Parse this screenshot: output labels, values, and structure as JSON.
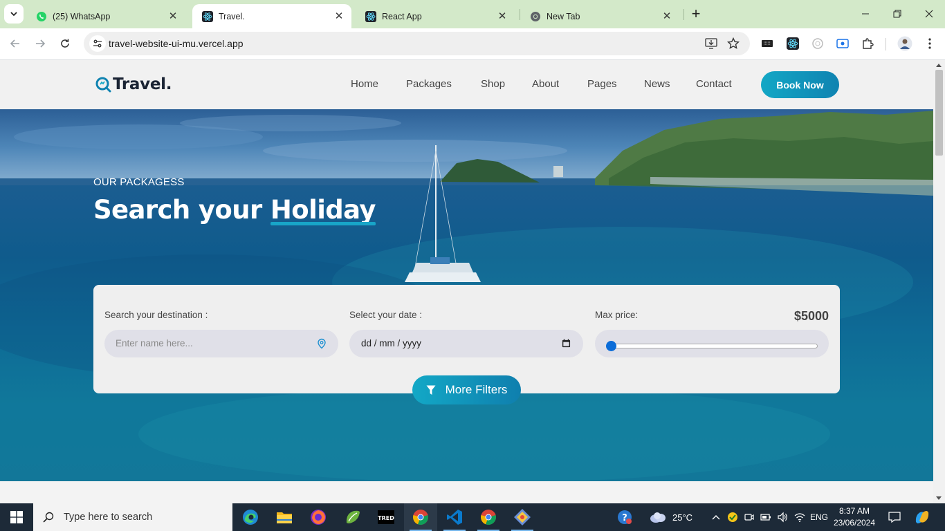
{
  "browser": {
    "tabs": [
      {
        "title": "(25) WhatsApp",
        "icon": "whatsapp-icon",
        "active": false
      },
      {
        "title": "Travel.",
        "icon": "react-icon",
        "active": true
      },
      {
        "title": "React App",
        "icon": "react-icon",
        "active": false
      },
      {
        "title": "New Tab",
        "icon": "chrome-icon",
        "active": false
      }
    ],
    "url": "travel-website-ui-mu.vercel.app"
  },
  "site": {
    "logo": "Travel.",
    "nav": [
      "Home",
      "Packages",
      "Shop",
      "About",
      "Pages",
      "News",
      "Contact"
    ],
    "book_button": "Book Now"
  },
  "hero": {
    "subtitle": "OUR PACKAGESS",
    "title_part1": "Search your ",
    "title_highlight": "Holiday"
  },
  "search": {
    "destination_label": "Search your destination :",
    "destination_placeholder": "Enter name here...",
    "date_label": "Select your date :",
    "date_value": "dd / mm / yyyy",
    "price_label": "Max price:",
    "price_value": "$5000",
    "price_slider_fraction": 0,
    "more_filters": "More Filters"
  },
  "taskbar": {
    "search_placeholder": "Type here to search",
    "weather": "25°C",
    "language": "ENG",
    "time": "8:37 AM",
    "date": "23/06/2024"
  },
  "colors": {
    "accent": "#13a7c5",
    "tab_strip": "#d3e9c9",
    "taskbar": "#1d2a38"
  }
}
